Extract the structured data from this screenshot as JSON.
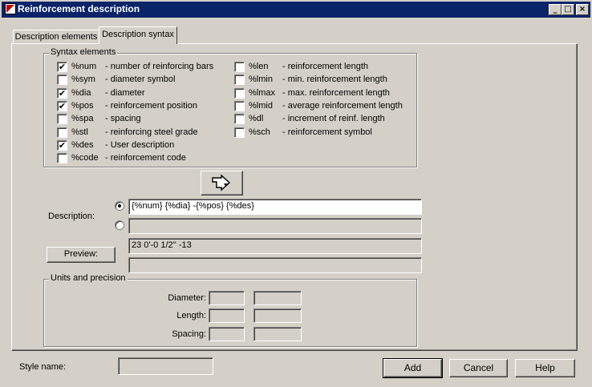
{
  "window": {
    "title": "Reinforcement description",
    "controls": {
      "minimize": "_",
      "maximize": "□",
      "close": "×"
    }
  },
  "tabs": [
    {
      "label": "Description elements",
      "active": false
    },
    {
      "label": "Description syntax",
      "active": true
    }
  ],
  "syntax": {
    "group_label": "Syntax elements",
    "left": [
      {
        "code": "%num",
        "desc": "- number of reinforcing bars",
        "checked": true
      },
      {
        "code": "%sym",
        "desc": "- diameter symbol",
        "checked": false
      },
      {
        "code": "%dia",
        "desc": "- diameter",
        "checked": true
      },
      {
        "code": "%pos",
        "desc": "- reinforcement position",
        "checked": true
      },
      {
        "code": "%spa",
        "desc": "- spacing",
        "checked": false
      },
      {
        "code": "%stl",
        "desc": "- reinforcing steel grade",
        "checked": false
      },
      {
        "code": "%des",
        "desc": "- User description",
        "checked": true
      },
      {
        "code": "%code",
        "desc": "- reinforcement code",
        "checked": false
      }
    ],
    "right": [
      {
        "code": "%len",
        "desc": "- reinforcement length",
        "checked": false
      },
      {
        "code": "%lmin",
        "desc": "- min. reinforcement length",
        "checked": false
      },
      {
        "code": "%lmax",
        "desc": "- max. reinforcement length",
        "checked": false
      },
      {
        "code": "%lmid",
        "desc": "- average reinforcement length",
        "checked": false
      },
      {
        "code": "%dl",
        "desc": "- increment of reinf. length",
        "checked": false
      },
      {
        "code": "%sch",
        "desc": "- reinforcement symbol",
        "checked": false
      }
    ],
    "check_glyph": "✔"
  },
  "description": {
    "label": "Description:",
    "line1_value": "{%num} {%dia} -{%pos} {%des}",
    "line2_value": "",
    "selected_line": 1
  },
  "preview": {
    "button_label": "Preview:",
    "line1": "23 0'-0 1/2'' -13",
    "line2": ""
  },
  "units": {
    "group_label": "Units and precision",
    "rows": [
      {
        "label": "Diameter:",
        "unit": "",
        "precision": ""
      },
      {
        "label": "Length:",
        "unit": "",
        "precision": ""
      },
      {
        "label": "Spacing:",
        "unit": "",
        "precision": ""
      }
    ]
  },
  "footer": {
    "style_name_label": "Style name:",
    "style_name_value": "",
    "add_label": "Add",
    "cancel_label": "Cancel",
    "help_label": "Help"
  },
  "icons": {
    "insert_button": "insert-arrow-icon",
    "app": "app-logo-icon"
  }
}
